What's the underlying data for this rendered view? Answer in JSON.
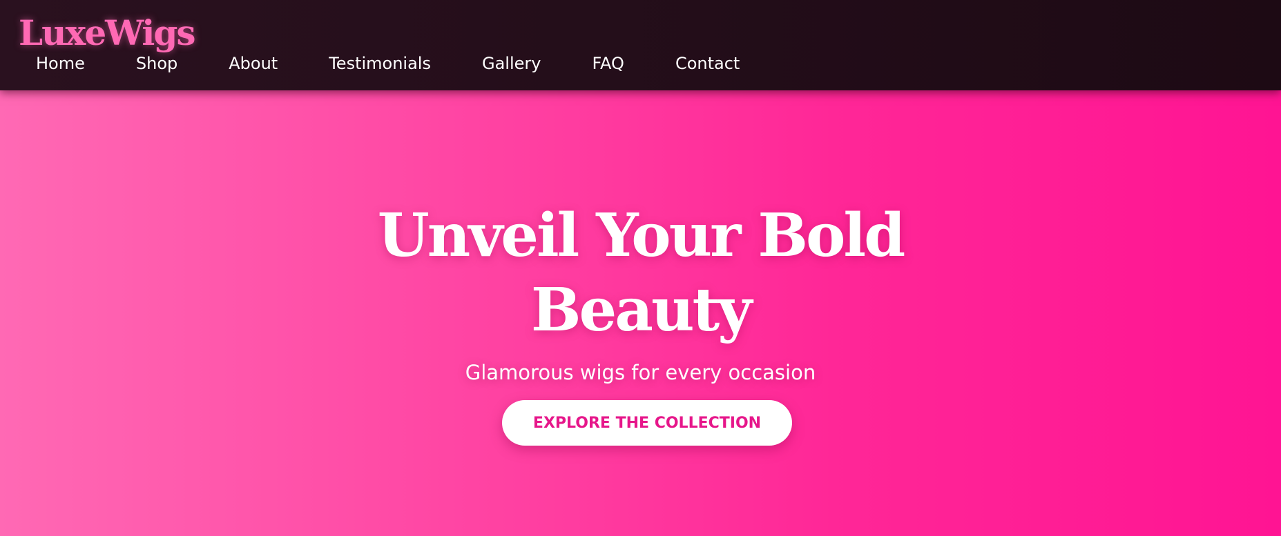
{
  "header": {
    "logo": "LuxeWigs",
    "nav": [
      {
        "label": "Home"
      },
      {
        "label": "Shop"
      },
      {
        "label": "About"
      },
      {
        "label": "Testimonials"
      },
      {
        "label": "Gallery"
      },
      {
        "label": "FAQ"
      },
      {
        "label": "Contact"
      }
    ]
  },
  "hero": {
    "title_line1": "Unveil Your Bold",
    "title_line2": "Beauty",
    "subtitle": "Glamorous wigs for every occasion",
    "cta_label": "EXPLORE THE COLLECTION"
  },
  "colors": {
    "header_bg": "#1d0a14",
    "logo": "#ff69b4",
    "hero_gradient_start": "#ff69b4",
    "hero_gradient_end": "#ff1493",
    "cta_text": "#e6168a",
    "cta_bg": "#ffffff"
  }
}
